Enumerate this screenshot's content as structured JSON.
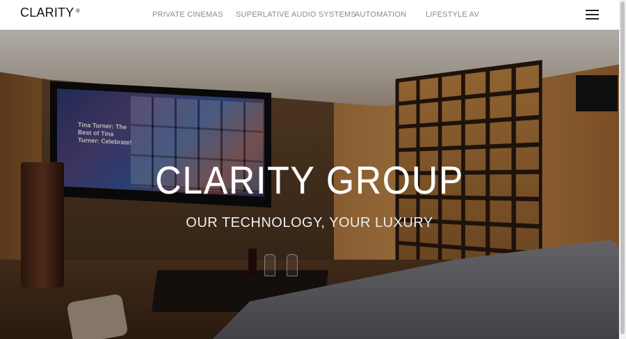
{
  "brand": {
    "name": "CLARITY",
    "mark": "®"
  },
  "nav": {
    "items": [
      {
        "label": "PRIVATE CINEMAS"
      },
      {
        "label": "SUPERLATIVE AUDIO SYSTEMS"
      },
      {
        "label": "AUTOMATION"
      },
      {
        "label": "LIFESTYLE AV"
      }
    ],
    "menu_icon": "hamburger-menu-icon"
  },
  "hero": {
    "title": "CLARITY GROUP",
    "subtitle": "OUR TECHNOLOGY, YOUR LUXURY",
    "screen_text": "Tina Turner: The Best of Tina Turner: Celebrate!"
  },
  "colors": {
    "nav_bg": "#ffffff",
    "nav_text": "#8a8a8a",
    "brand_text": "#111111",
    "hero_text": "#ffffff"
  }
}
